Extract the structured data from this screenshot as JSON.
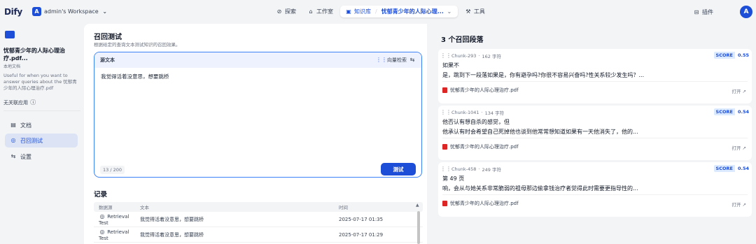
{
  "topbar": {
    "logo": "Dify",
    "workspace_initial": "A",
    "workspace_name": "admin's Workspace",
    "nav": {
      "explore": "探索",
      "studio": "工作室",
      "knowledge": "知识库",
      "kb_name": "忧郁青少年的人际心理...",
      "tools": "工具"
    },
    "plugins": "插件",
    "user_initial": "A"
  },
  "sidebar": {
    "title": "忧郁青少年的人际心理治疗.pdf...",
    "subtitle": "本地文档",
    "description": "Useful for when you want to answer queries about the 忧郁青少年的人际心理治疗.pdf",
    "no_app": "无关联应用",
    "items": [
      {
        "label": "文档",
        "icon": "document-icon"
      },
      {
        "label": "召回测试",
        "icon": "target-icon"
      },
      {
        "label": "设置",
        "icon": "settings-icon"
      }
    ]
  },
  "main": {
    "title": "召回测试",
    "description": "根据给定的查询文本测试知识的召回效果。",
    "source": {
      "label": "源文本",
      "vector_search": "向量检索",
      "text": "我觉得活着没意思，想要跳桥",
      "count": "13",
      "max": "200",
      "test_button": "测试"
    },
    "records": {
      "title": "记录",
      "headers": {
        "source": "数据源",
        "text": "文本",
        "time": "时间"
      },
      "rows": [
        {
          "source": "Retrieval Test",
          "text": "我觉得活着没意思，想要跳桥",
          "time": "2025-07-17 01:35"
        },
        {
          "source": "Retrieval Test",
          "text": "我觉得活着没意思，想要跳桥",
          "time": "2025-07-17 01:29"
        }
      ]
    }
  },
  "results": {
    "title": "3 个召回段落",
    "score_label": "SCORE",
    "open_label": "打开",
    "cards": [
      {
        "chunk": "Chunk-293",
        "chars": "162 字符",
        "score": "0.55",
        "line1": "如果不",
        "line2": "是，跳到下一段落如果是，你有避孕吗?你很不容易兴奋吗?性关系较少发生吗？...",
        "file": "忧郁青少年的人际心理治疗.pdf"
      },
      {
        "chunk": "Chunk-1041",
        "chars": "134 字符",
        "score": "0.54",
        "line1": "他否认有想自杀的感觉，但",
        "line2": "他承认有时会希望自己死掉他也谈到他常常想知道如果有一天他消失了，他的...",
        "file": "忧郁青少年的人际心理治疗.pdf"
      },
      {
        "chunk": "Chunk-458",
        "chars": "249 字符",
        "score": "0.54",
        "line1": "第 49 页",
        "line2": "响，会从与她关系非常脆弱的祖母那边偷拿钱治疗者觉得此时需要更指导性的...",
        "file": "忧郁青少年的人际心理治疗.pdf"
      }
    ]
  },
  "colors": {
    "accent": "#1d4ed8",
    "border_active": "#3b82f6",
    "pdf": "#dc2626"
  }
}
